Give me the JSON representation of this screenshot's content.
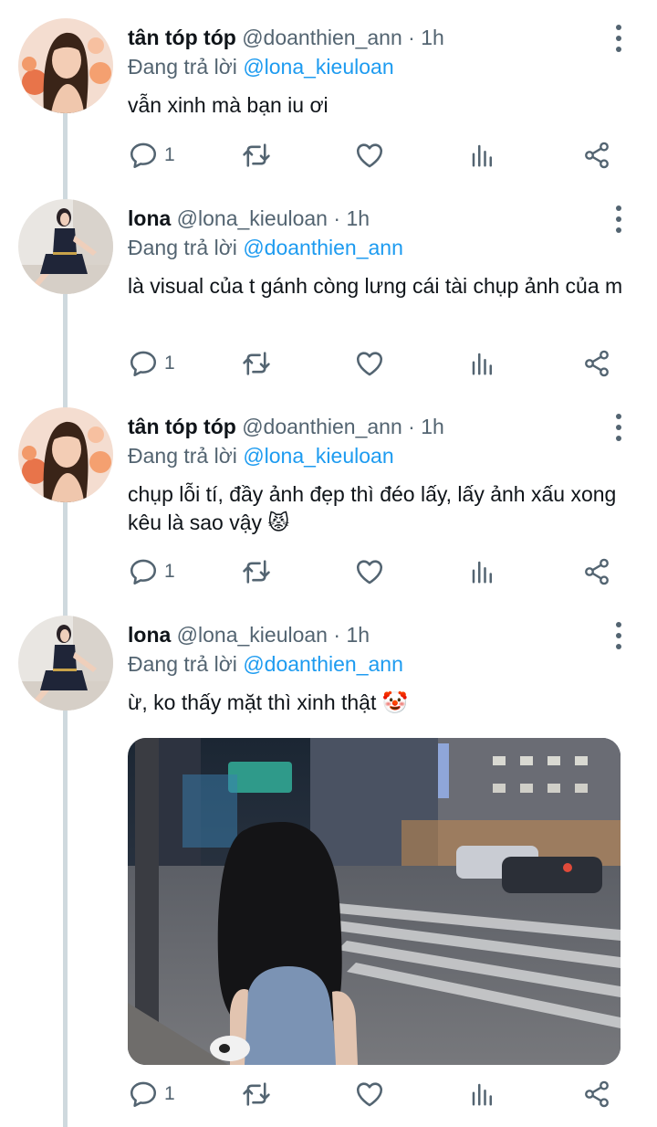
{
  "tweets": [
    {
      "name": "tân tóp tóp",
      "handle": "@doanthien_ann",
      "time": "1h",
      "replying_label": "Đang trả lời",
      "replying_to": "@lona_kieuloan",
      "text": "vẫn xinh mà bạn iu ơi",
      "reply_count": "1"
    },
    {
      "name": "lona",
      "handle": "@lona_kieuloan",
      "time": "1h",
      "replying_label": "Đang trả lời",
      "replying_to": "@doanthien_ann",
      "text": "là visual của t gánh còng lưng cái tài chụp ảnh của m",
      "reply_count": "1"
    },
    {
      "name": "tân tóp tóp",
      "handle": "@doanthien_ann",
      "time": "1h",
      "replying_label": "Đang trả lời",
      "replying_to": "@lona_kieuloan",
      "text": "chụp lỗi tí, đầy ảnh đẹp thì đéo lấy, lấy ảnh xấu xong kêu là sao vậy 😾",
      "reply_count": "1"
    },
    {
      "name": "lona",
      "handle": "@lona_kieuloan",
      "time": "1h",
      "replying_label": "Đang trả lời",
      "replying_to": "@doanthien_ann",
      "text": "ừ, ko thấy mặt thì xinh thật 🤡",
      "reply_count": "1"
    }
  ],
  "separator": " · ",
  "colors": {
    "text": "#0f1419",
    "muted": "#536471",
    "link": "#1d9bf0",
    "thread_line": "#cfd9de"
  }
}
